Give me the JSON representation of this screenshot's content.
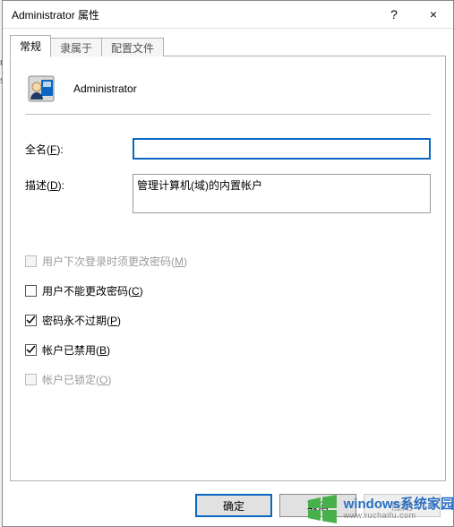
{
  "window": {
    "title": "Administrator 属性",
    "help_label": "?",
    "close_label": "×"
  },
  "tabs": {
    "general": "常规",
    "memberof": "隶属于",
    "profile": "配置文件"
  },
  "header": {
    "account_name": "Administrator"
  },
  "form": {
    "fullname_pre": "全名(",
    "fullname_mn": "F",
    "fullname_post": "):",
    "fullname_value": "",
    "desc_pre": "描述(",
    "desc_mn": "D",
    "desc_post": "):",
    "desc_value": "管理计算机(域)的内置帐户"
  },
  "checks": {
    "c1_pre": "用户下次登录时须更改密码(",
    "c1_mn": "M",
    "c1_post": ")",
    "c2_pre": "用户不能更改密码(",
    "c2_mn": "C",
    "c2_post": ")",
    "c3_pre": "密码永不过期(",
    "c3_mn": "P",
    "c3_post": ")",
    "c4_pre": "帐户已禁用(",
    "c4_mn": "B",
    "c4_post": ")",
    "c5_pre": "帐户已锁定(",
    "c5_mn": "O",
    "c5_post": ")"
  },
  "buttons": {
    "ok": "确定",
    "cancel": "取消",
    "apply": "应用"
  },
  "watermark": {
    "line1": "windows系统家园",
    "line2": "www.ruchaifu.com"
  },
  "side_clip": "ni\ns\n "
}
